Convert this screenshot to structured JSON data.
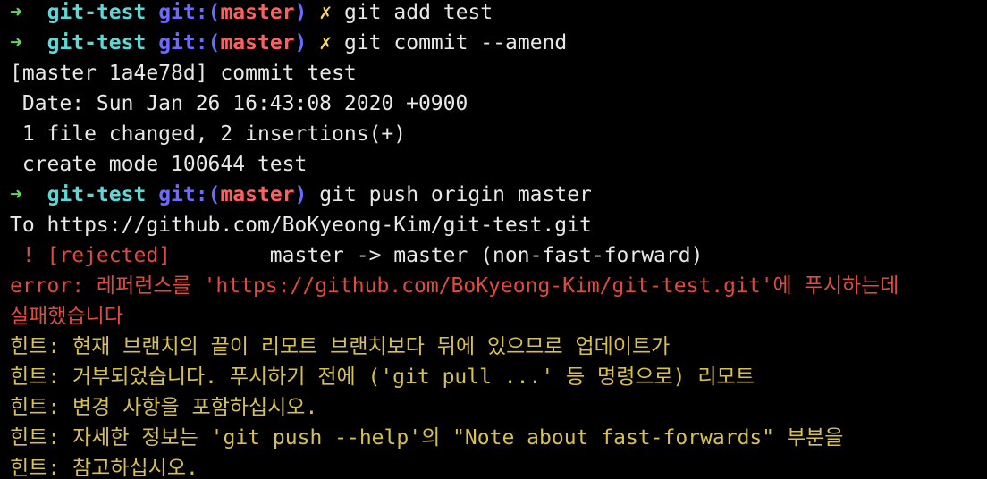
{
  "prompt": {
    "arrow": "➜",
    "dir": "git-test",
    "git_label": "git:(",
    "branch": "master",
    "close_paren": ")",
    "dirty_mark": "✗"
  },
  "lines": {
    "l1": {
      "cmd": "git add test"
    },
    "l2": {
      "cmd": "git commit --amend"
    },
    "l3": {
      "text": "[master 1a4e78d] commit test"
    },
    "l4": {
      "text": " Date: Sun Jan 26 16:43:08 2020 +0900"
    },
    "l5": {
      "text": " 1 file changed, 2 insertions(+)"
    },
    "l6": {
      "text": " create mode 100644 test"
    },
    "l7": {
      "cmd": "git push origin master"
    },
    "l8": {
      "text": "To https://github.com/BoKyeong-Kim/git-test.git"
    },
    "l9": {
      "rejected": " ! [rejected]",
      "rest": "        master -> master (non-fast-forward)"
    },
    "l10": {
      "text": "error: 레퍼런스를 'https://github.com/BoKyeong-Kim/git-test.git'에 푸시하는데"
    },
    "l11": {
      "text": "실패했습니다"
    },
    "l12": {
      "text": "힌트: 현재 브랜치의 끝이 리모트 브랜치보다 뒤에 있으므로 업데이트가"
    },
    "l13": {
      "text": "힌트: 거부되었습니다. 푸시하기 전에 ('git pull ...' 등 명령으로) 리모트"
    },
    "l14": {
      "text": "힌트: 변경 사항을 포함하십시오."
    },
    "l15": {
      "text": "힌트: 자세한 정보는 'git push --help'의 \"Note about fast-forwards\" 부분을"
    },
    "l16": {
      "text": "힌트: 참고하십시오."
    }
  },
  "colors": {
    "background": "#000000",
    "prompt_arrow": "#5fd75f",
    "prompt_dir": "#5fd7d7",
    "prompt_git": "#6a6aff",
    "prompt_branch": "#ff5f5f",
    "prompt_dirty": "#ffd75f",
    "error_red": "#e04a3f",
    "hint_yellow": "#d7c14b",
    "text": "#e8e8e8"
  }
}
